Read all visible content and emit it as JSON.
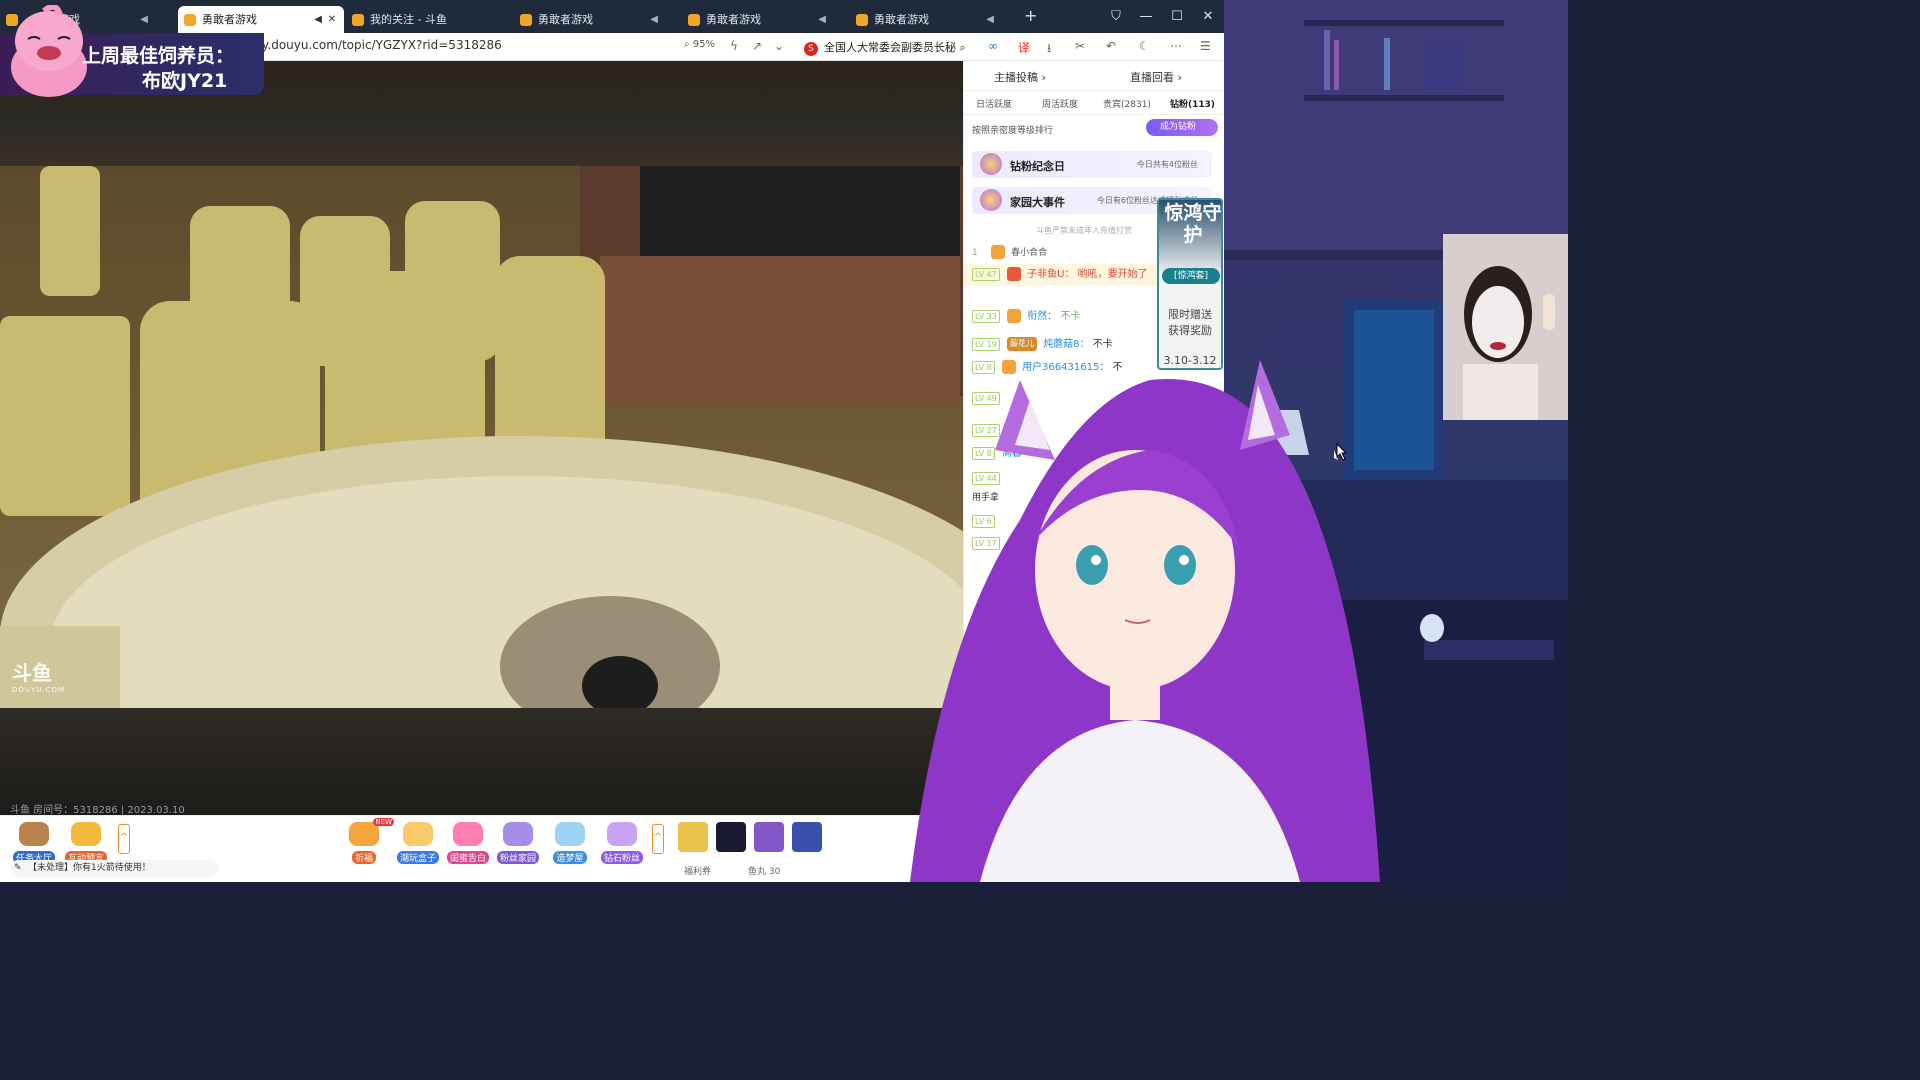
{
  "browser": {
    "tabs": [
      {
        "label": "游戏",
        "audio": "◀"
      },
      {
        "label": "勇敢者游戏",
        "audio": "◀",
        "close": "✕"
      },
      {
        "label": "我的关注 - 斗鱼"
      },
      {
        "label": "勇敢者游戏",
        "audio": "◀"
      },
      {
        "label": "勇敢者游戏",
        "audio": "◀"
      },
      {
        "label": "勇敢者游戏",
        "audio": "◀"
      }
    ],
    "new_tab": "+",
    "window_controls": {
      "minimize": "—",
      "maximize": "☐",
      "close": "✕"
    },
    "url": "y.douyu.com/topic/YGZYX?rid=5318286",
    "zoom": "95%",
    "search_text": "全国人大常委会副委员长秘"
  },
  "banner": {
    "line1": "上周最佳饲养员：",
    "line2": "布欧JY21"
  },
  "video": {
    "watermark": "斗鱼",
    "watermark_sub": "DOUYU.COM",
    "room_info": "斗鱼 房间号：5318286 | 2023.03.10"
  },
  "video_bar": {
    "left_buttons": [
      "任务大厅",
      "互动预言"
    ],
    "mid_buttons": [
      "祈福",
      "潮玩盒子",
      "闺蜜告白",
      "粉丝家园",
      "造梦屋",
      "钻石粉丝"
    ],
    "new_tag": "NEW",
    "notice": "【未处理】你有1火箭待使用！",
    "footer_labels": [
      "福利券",
      "鱼丸 30"
    ]
  },
  "panel": {
    "top_links": [
      "主播投稿 ›",
      "直播回看 ›"
    ],
    "tabs": [
      "日活跃度",
      "周活跃度",
      "贵宾(2831)",
      "钻粉(113)"
    ],
    "rank_text": "按照亲密度等级排行",
    "become_btn": "成为钻粉",
    "cards": [
      {
        "name": "钻粉纪念日",
        "sub": "今日共有4位粉丝"
      },
      {
        "name": "家园大事件",
        "sub": "今日有6位粉丝达成福利成就"
      }
    ],
    "warning": "斗鱼严禁未成年人充值打赏",
    "rank_row": {
      "num": "1",
      "name": "春小合合"
    },
    "chat": [
      {
        "lv": "LV 47",
        "user": "子非鱼U：",
        "msg": "哟吼，要开始了",
        "highlight": true
      },
      {
        "lv": "LV 33",
        "user": "衔然：",
        "msg": "不卡"
      },
      {
        "lv": "LV 19",
        "user": "炖蘑菇8：",
        "msg": "不卡",
        "badge": "藤花儿"
      },
      {
        "lv": "LV 8",
        "user": "用户366431615：",
        "msg": "不"
      },
      {
        "lv": "LV 49",
        "user": "",
        "msg": ""
      },
      {
        "lv": "LV 27",
        "user": "",
        "msg": ""
      },
      {
        "lv": "LV 8",
        "user": "离暮",
        "msg": ""
      },
      {
        "lv": "LV 44",
        "user": "",
        "msg": ""
      },
      {
        "lv": "",
        "user": "",
        "msg": "用手拿"
      },
      {
        "lv": "LV 6",
        "user": "",
        "msg": ""
      },
      {
        "lv": "LV 17",
        "user": "",
        "msg": ""
      }
    ]
  },
  "promo": {
    "title": "惊鸿守护",
    "tag": "[惊鸿套]",
    "line1": "限时赠送",
    "line2": "获得奖励",
    "date": "3.10-3.12"
  },
  "colors": {
    "tabbar": "#1f2b3a",
    "accent": "#f08a24",
    "avatar_hair": "#9b3fd1",
    "level_green": "#9ac95f"
  }
}
